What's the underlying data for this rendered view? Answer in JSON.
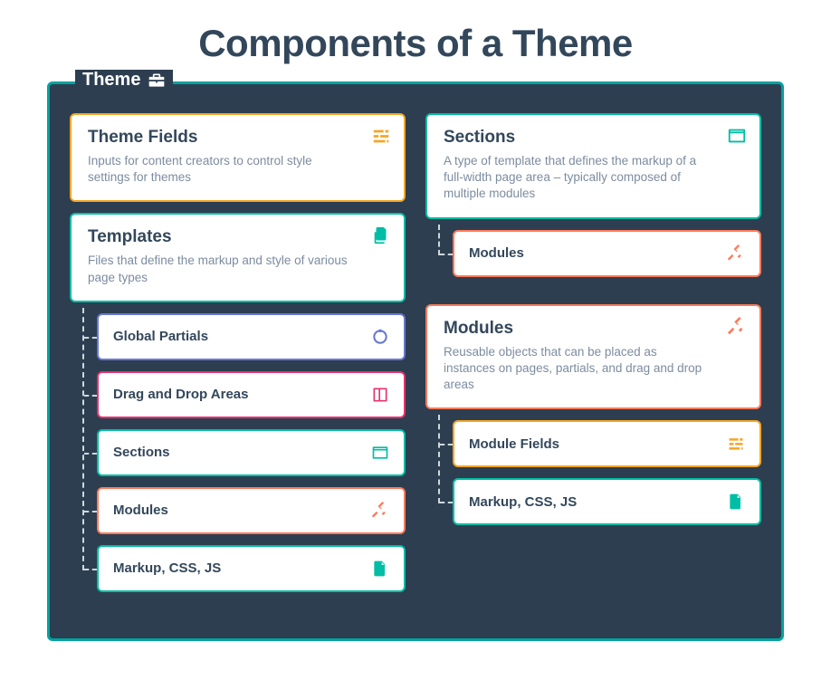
{
  "title": "Components of a Theme",
  "legend": "Theme",
  "left": {
    "themeFields": {
      "title": "Theme Fields",
      "desc": "Inputs for content creators to control style settings for themes"
    },
    "templates": {
      "title": "Templates",
      "desc": "Files that define the markup and style of various page types",
      "children": {
        "globalPartials": "Global Partials",
        "dragDrop": "Drag and Drop Areas",
        "sections": "Sections",
        "modules": "Modules",
        "markup": "Markup, CSS, JS"
      }
    }
  },
  "right": {
    "sections": {
      "title": "Sections",
      "desc": "A type of template that defines the markup of a full-width page area – typically composed of multiple modules",
      "children": {
        "modules": "Modules"
      }
    },
    "modules": {
      "title": "Modules",
      "desc": "Reusable objects that can be placed as instances on pages, partials, and drag and drop areas",
      "children": {
        "moduleFields": "Module Fields",
        "markup": "Markup, CSS, JS"
      }
    }
  }
}
